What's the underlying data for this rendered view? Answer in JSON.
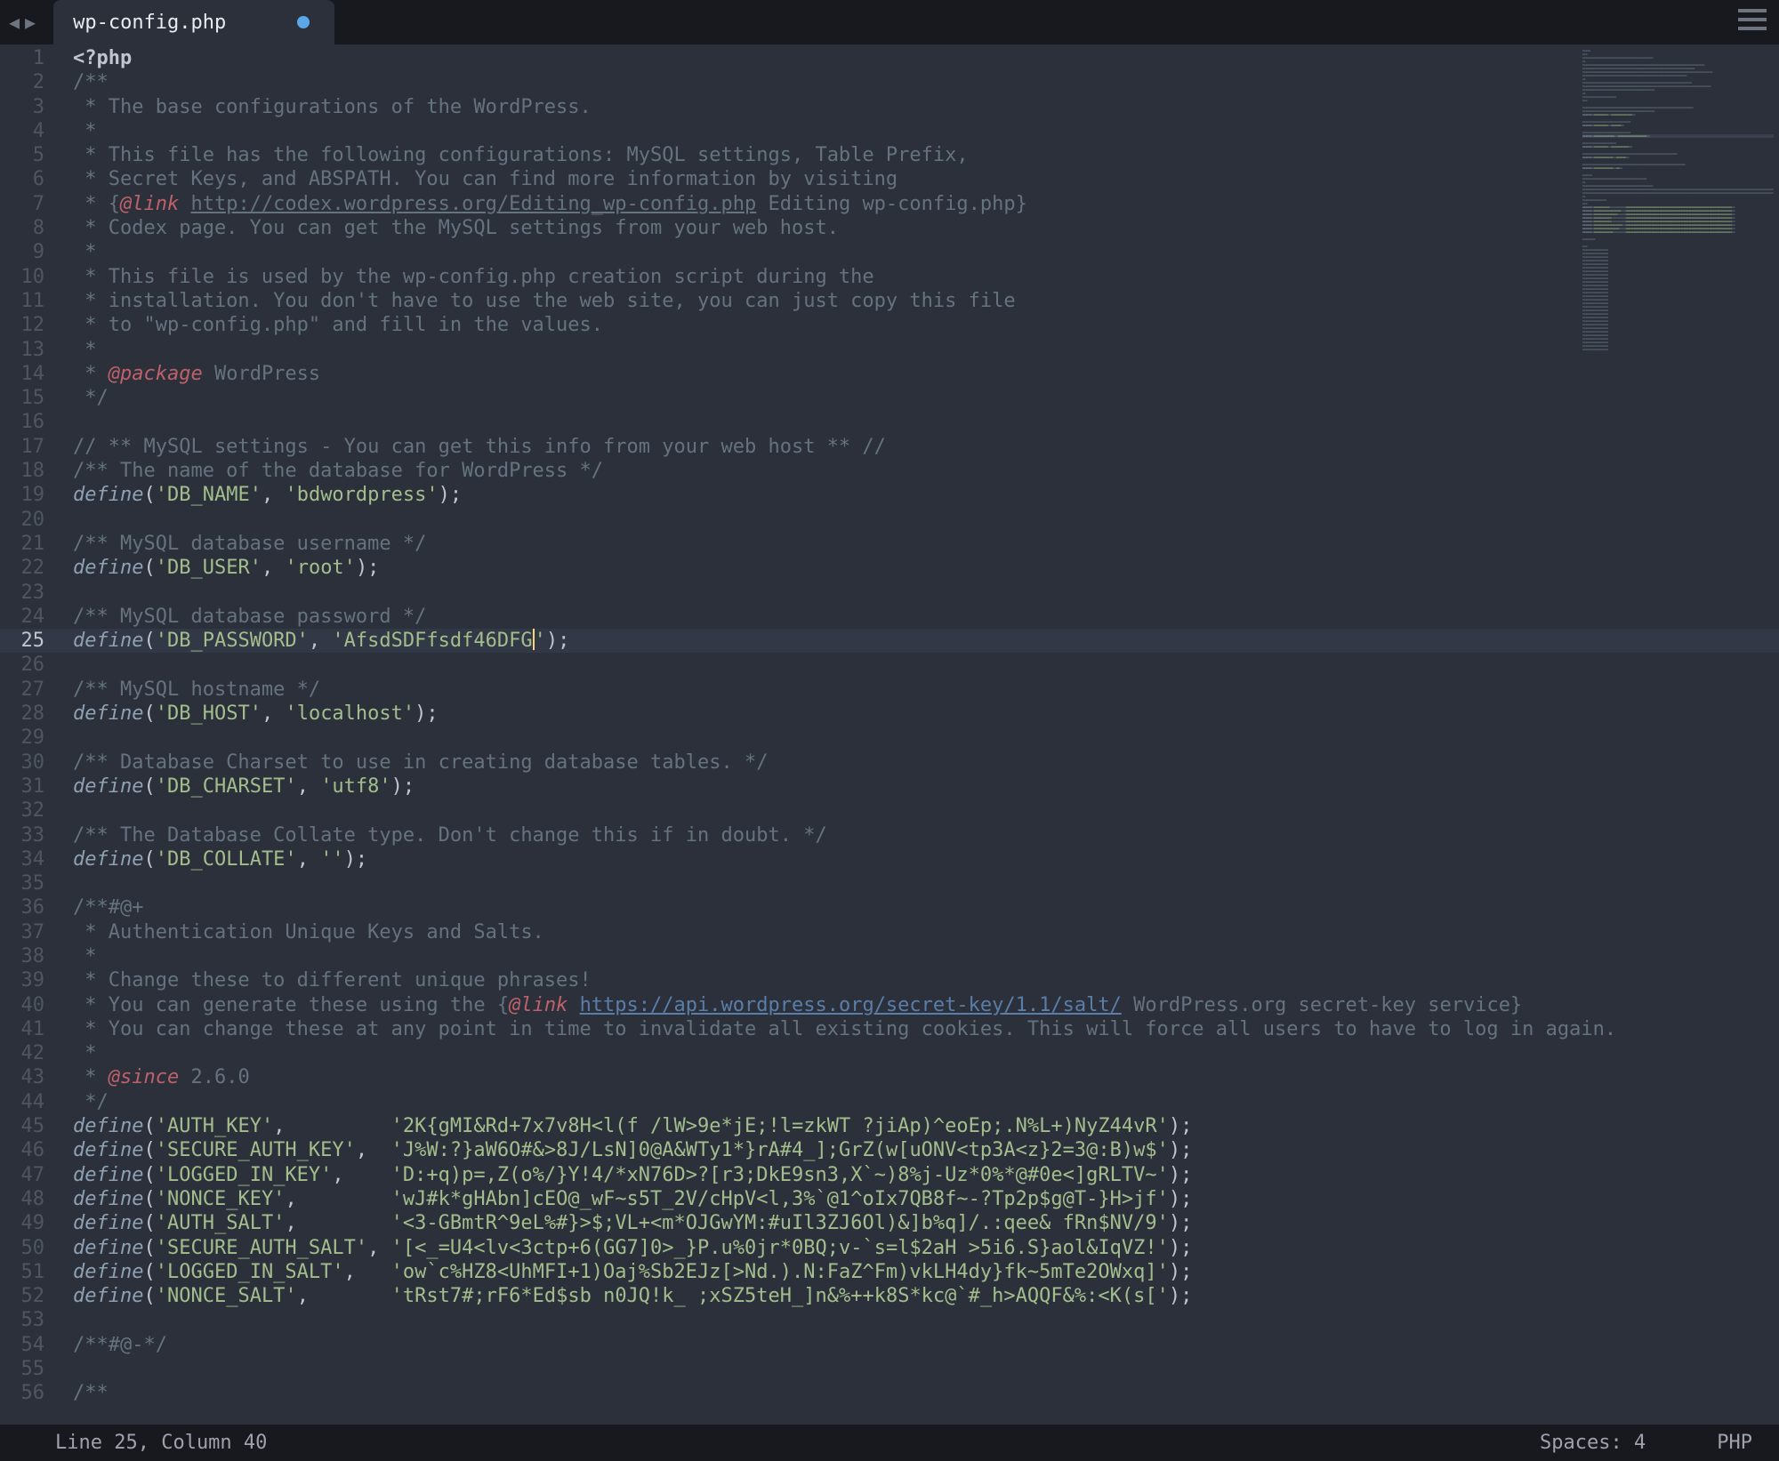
{
  "tab": {
    "filename": "wp-config.php",
    "modified": true
  },
  "status": {
    "pos": "Line 25, Column 40",
    "spaces": "Spaces: 4",
    "lang": "PHP"
  },
  "cursor": {
    "line": 25,
    "col": 40
  },
  "lines": [
    {
      "n": 1,
      "t": [
        [
          "phpopen",
          "<?php"
        ]
      ]
    },
    {
      "n": 2,
      "t": [
        [
          "c",
          "/**"
        ]
      ]
    },
    {
      "n": 3,
      "t": [
        [
          "c",
          " * The base configurations of the WordPress."
        ]
      ]
    },
    {
      "n": 4,
      "t": [
        [
          "c",
          " *"
        ]
      ]
    },
    {
      "n": 5,
      "t": [
        [
          "c",
          " * This file has the following configurations: MySQL settings, Table Prefix,"
        ]
      ]
    },
    {
      "n": 6,
      "t": [
        [
          "c",
          " * Secret Keys, and ABSPATH. You can find more information by visiting"
        ]
      ]
    },
    {
      "n": 7,
      "t": [
        [
          "c",
          " * {"
        ],
        [
          "tag",
          "@link"
        ],
        [
          "c",
          " "
        ],
        [
          "url2",
          "http://codex.wordpress.org/Editing_wp-config.php"
        ],
        [
          "c",
          " Editing wp-config.php}"
        ]
      ]
    },
    {
      "n": 8,
      "t": [
        [
          "c",
          " * Codex page. You can get the MySQL settings from your web host."
        ]
      ]
    },
    {
      "n": 9,
      "t": [
        [
          "c",
          " *"
        ]
      ]
    },
    {
      "n": 10,
      "t": [
        [
          "c",
          " * This file is used by the wp-config.php creation script during the"
        ]
      ]
    },
    {
      "n": 11,
      "t": [
        [
          "c",
          " * installation. You don't have to use the web site, you can just copy this file"
        ]
      ]
    },
    {
      "n": 12,
      "t": [
        [
          "c",
          " * to \"wp-config.php\" and fill in the values."
        ]
      ]
    },
    {
      "n": 13,
      "t": [
        [
          "c",
          " *"
        ]
      ]
    },
    {
      "n": 14,
      "t": [
        [
          "c",
          " * "
        ],
        [
          "tag",
          "@package"
        ],
        [
          "c",
          " WordPress"
        ]
      ]
    },
    {
      "n": 15,
      "t": [
        [
          "c",
          " */"
        ]
      ]
    },
    {
      "n": 16,
      "t": []
    },
    {
      "n": 17,
      "t": [
        [
          "c",
          "// ** MySQL settings - You can get this info from your web host ** //"
        ]
      ]
    },
    {
      "n": 18,
      "t": [
        [
          "c",
          "/** The name of the database for WordPress */"
        ]
      ]
    },
    {
      "n": 19,
      "t": [
        [
          "kw",
          "define"
        ],
        [
          "p",
          "("
        ],
        [
          "s",
          "'DB_NAME'"
        ],
        [
          "p",
          ", "
        ],
        [
          "s",
          "'bdwordpress'"
        ],
        [
          "p",
          ");"
        ]
      ]
    },
    {
      "n": 20,
      "t": []
    },
    {
      "n": 21,
      "t": [
        [
          "c",
          "/** MySQL database username */"
        ]
      ]
    },
    {
      "n": 22,
      "t": [
        [
          "kw",
          "define"
        ],
        [
          "p",
          "("
        ],
        [
          "s",
          "'DB_USER'"
        ],
        [
          "p",
          ", "
        ],
        [
          "s",
          "'root'"
        ],
        [
          "p",
          ");"
        ]
      ]
    },
    {
      "n": 23,
      "t": []
    },
    {
      "n": 24,
      "t": [
        [
          "c",
          "/** MySQL database password */"
        ]
      ]
    },
    {
      "n": 25,
      "current": true,
      "t": [
        [
          "kw",
          "define"
        ],
        [
          "p",
          "("
        ],
        [
          "s",
          "'DB_PASSWORD'"
        ],
        [
          "p",
          ", "
        ],
        [
          "s",
          "'AfsdSDFfsdf46DFG"
        ],
        [
          "cursor",
          ""
        ],
        [
          "s",
          "'"
        ],
        [
          "p",
          ");"
        ]
      ]
    },
    {
      "n": 26,
      "t": []
    },
    {
      "n": 27,
      "t": [
        [
          "c",
          "/** MySQL hostname */"
        ]
      ]
    },
    {
      "n": 28,
      "t": [
        [
          "kw",
          "define"
        ],
        [
          "p",
          "("
        ],
        [
          "s",
          "'DB_HOST'"
        ],
        [
          "p",
          ", "
        ],
        [
          "s",
          "'localhost'"
        ],
        [
          "p",
          ");"
        ]
      ]
    },
    {
      "n": 29,
      "t": []
    },
    {
      "n": 30,
      "t": [
        [
          "c",
          "/** Database Charset to use in creating database tables. */"
        ]
      ]
    },
    {
      "n": 31,
      "t": [
        [
          "kw",
          "define"
        ],
        [
          "p",
          "("
        ],
        [
          "s",
          "'DB_CHARSET'"
        ],
        [
          "p",
          ", "
        ],
        [
          "s",
          "'utf8'"
        ],
        [
          "p",
          ");"
        ]
      ]
    },
    {
      "n": 32,
      "t": []
    },
    {
      "n": 33,
      "t": [
        [
          "c",
          "/** The Database Collate type. Don't change this if in doubt. */"
        ]
      ]
    },
    {
      "n": 34,
      "t": [
        [
          "kw",
          "define"
        ],
        [
          "p",
          "("
        ],
        [
          "s",
          "'DB_COLLATE'"
        ],
        [
          "p",
          ", "
        ],
        [
          "s",
          "''"
        ],
        [
          "p",
          ");"
        ]
      ]
    },
    {
      "n": 35,
      "t": []
    },
    {
      "n": 36,
      "t": [
        [
          "c",
          "/**#@+"
        ]
      ]
    },
    {
      "n": 37,
      "t": [
        [
          "c",
          " * Authentication Unique Keys and Salts."
        ]
      ]
    },
    {
      "n": 38,
      "t": [
        [
          "c",
          " *"
        ]
      ]
    },
    {
      "n": 39,
      "t": [
        [
          "c",
          " * Change these to different unique phrases!"
        ]
      ]
    },
    {
      "n": 40,
      "t": [
        [
          "c",
          " * You can generate these using the {"
        ],
        [
          "tag",
          "@link"
        ],
        [
          "c",
          " "
        ],
        [
          "url",
          "https://api.wordpress.org/secret-key/1.1/salt/"
        ],
        [
          "c",
          " WordPress.org secret-key service}"
        ]
      ]
    },
    {
      "n": 41,
      "t": [
        [
          "c",
          " * You can change these at any point in time to invalidate all existing cookies. This will force all users to have to log in again."
        ]
      ]
    },
    {
      "n": 42,
      "t": [
        [
          "c",
          " *"
        ]
      ]
    },
    {
      "n": 43,
      "t": [
        [
          "c",
          " * "
        ],
        [
          "tag",
          "@since"
        ],
        [
          "c",
          " 2.6.0"
        ]
      ]
    },
    {
      "n": 44,
      "t": [
        [
          "c",
          " */"
        ]
      ]
    },
    {
      "n": 45,
      "t": [
        [
          "kw",
          "define"
        ],
        [
          "p",
          "("
        ],
        [
          "s",
          "'AUTH_KEY'"
        ],
        [
          "p",
          ",         "
        ],
        [
          "s",
          "'2K{gMI&Rd+7x7v8H<l(f /lW>9e*jE;!l=zkWT ?jiAp)^eoEp;.N%L+)NyZ44vR'"
        ],
        [
          "p",
          ");"
        ]
      ]
    },
    {
      "n": 46,
      "t": [
        [
          "kw",
          "define"
        ],
        [
          "p",
          "("
        ],
        [
          "s",
          "'SECURE_AUTH_KEY'"
        ],
        [
          "p",
          ",  "
        ],
        [
          "s",
          "'J%W:?}aW6O#&>8J/LsN]0@A&WTy1*}rA#4_];GrZ(w[uONV<tp3A<z}2=3@:B)w$'"
        ],
        [
          "p",
          ");"
        ]
      ]
    },
    {
      "n": 47,
      "t": [
        [
          "kw",
          "define"
        ],
        [
          "p",
          "("
        ],
        [
          "s",
          "'LOGGED_IN_KEY'"
        ],
        [
          "p",
          ",    "
        ],
        [
          "s",
          "'D:+q)p=,Z(o%/}Y!4/*xN76D>?[r3;DkE9sn3,X`~)8%j-Uz*0%*@#0e<]gRLTV~'"
        ],
        [
          "p",
          ");"
        ]
      ]
    },
    {
      "n": 48,
      "t": [
        [
          "kw",
          "define"
        ],
        [
          "p",
          "("
        ],
        [
          "s",
          "'NONCE_KEY'"
        ],
        [
          "p",
          ",        "
        ],
        [
          "s",
          "'wJ#k*gHAbn]cEO@_wF~s5T_2V/cHpV<l,3%`@1^oIx7QB8f~-?Tp2p$g@T-}H>jf'"
        ],
        [
          "p",
          ");"
        ]
      ]
    },
    {
      "n": 49,
      "t": [
        [
          "kw",
          "define"
        ],
        [
          "p",
          "("
        ],
        [
          "s",
          "'AUTH_SALT'"
        ],
        [
          "p",
          ",        "
        ],
        [
          "s",
          "'<3-GBmtR^9eL%#}>$;VL+<m*OJGwYM:#uIl3ZJ6Ol)&]b%q]/.:qee& fRn$NV/9'"
        ],
        [
          "p",
          ");"
        ]
      ]
    },
    {
      "n": 50,
      "t": [
        [
          "kw",
          "define"
        ],
        [
          "p",
          "("
        ],
        [
          "s",
          "'SECURE_AUTH_SALT'"
        ],
        [
          "p",
          ", "
        ],
        [
          "s",
          "'[<_=U4<lv<3ctp+6(GG7]0>_}P.u%0jr*0BQ;v-`s=l$2aH >5i6.S}aol&IqVZ!'"
        ],
        [
          "p",
          ");"
        ]
      ]
    },
    {
      "n": 51,
      "t": [
        [
          "kw",
          "define"
        ],
        [
          "p",
          "("
        ],
        [
          "s",
          "'LOGGED_IN_SALT'"
        ],
        [
          "p",
          ",   "
        ],
        [
          "s",
          "'ow`c%HZ8<UhMFI+1)Oaj%Sb2EJz[>Nd.).N:FaZ^Fm)vkLH4dy}fk~5mTe2OWxq]'"
        ],
        [
          "p",
          ");"
        ]
      ]
    },
    {
      "n": 52,
      "t": [
        [
          "kw",
          "define"
        ],
        [
          "p",
          "("
        ],
        [
          "s",
          "'NONCE_SALT'"
        ],
        [
          "p",
          ",       "
        ],
        [
          "s",
          "'tRst7#;rF6*Ed$sb n0JQ!k_ ;xSZ5teH_]n&%++k8S*kc@`#_h>AQQF&%:<K(s['"
        ],
        [
          "p",
          ");"
        ]
      ]
    },
    {
      "n": 53,
      "t": []
    },
    {
      "n": 54,
      "t": [
        [
          "c",
          "/**#@-*/"
        ]
      ]
    },
    {
      "n": 55,
      "t": []
    },
    {
      "n": 56,
      "t": [
        [
          "c",
          "/**"
        ]
      ]
    }
  ]
}
